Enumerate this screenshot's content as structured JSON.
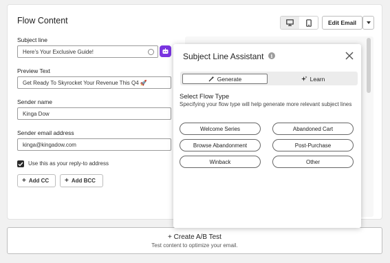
{
  "page": {
    "title": "Flow Content"
  },
  "toolbar": {
    "edit_email_label": "Edit Email",
    "desktop_icon": "monitor-icon",
    "mobile_icon": "phone-icon"
  },
  "form": {
    "subject": {
      "label": "Subject line",
      "value": "Here’s Your Exclusive Guide!"
    },
    "preview": {
      "label": "Preview Text",
      "value": "Get Ready To Skyrocket Your Revenue This Q4 🚀"
    },
    "sender_name": {
      "label": "Sender name",
      "value": "Kinga Dow"
    },
    "sender_email": {
      "label": "Sender email address",
      "value": "kinga@kingadow.com"
    },
    "reply_to": {
      "label": "Use this as your reply-to address",
      "checked": true
    },
    "add_cc": "Add CC",
    "add_bcc": "Add BCC"
  },
  "ab_test": {
    "title": "+ Create A/B Test",
    "subtitle": "Test content to optimize your email."
  },
  "assistant": {
    "title": "Subject Line Assistant",
    "tabs": [
      {
        "label": "Generate",
        "active": true
      },
      {
        "label": "Learn",
        "active": false
      }
    ],
    "section_title": "Select Flow Type",
    "section_desc": "Specifying your flow type will help generate more relevant subject lines",
    "flow_types": [
      "Welcome Series",
      "Abandoned Cart",
      "Browse Abandonment",
      "Post-Purchase",
      "Winback",
      "Other"
    ]
  },
  "colors": {
    "accent_purple": "#7a35e0",
    "background": "#f1f1f1"
  }
}
